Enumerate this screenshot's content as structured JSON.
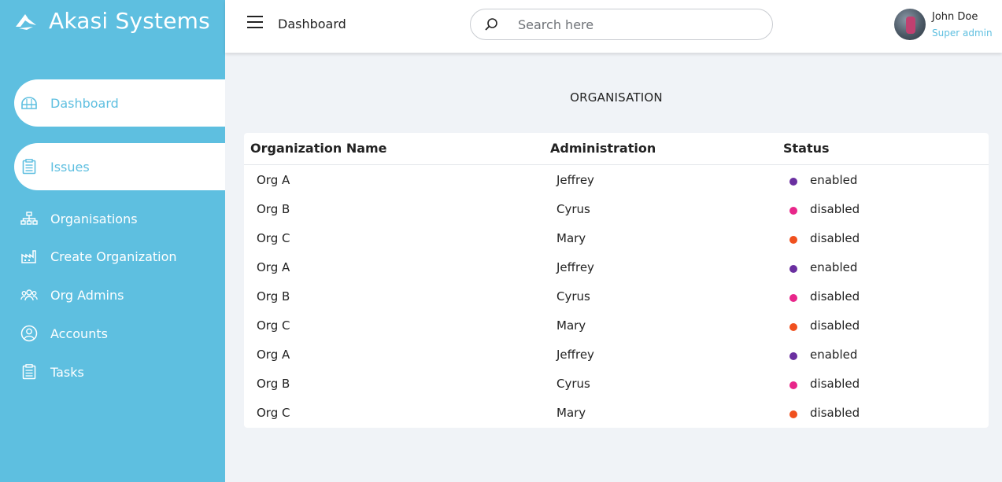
{
  "brand": {
    "name": "Akasi Systems"
  },
  "sidebar": {
    "items": [
      {
        "label": "Dashboard",
        "icon": "dome-icon",
        "active": true
      },
      {
        "label": "Issues",
        "icon": "clipboard-list-icon",
        "active": true
      },
      {
        "label": "Organisations",
        "icon": "org-chart-icon",
        "active": false
      },
      {
        "label": "Create Organization",
        "icon": "factory-icon",
        "active": false
      },
      {
        "label": "Org Admins",
        "icon": "group-icon",
        "active": false
      },
      {
        "label": "Accounts",
        "icon": "user-circle-icon",
        "active": false
      },
      {
        "label": "Tasks",
        "icon": "clipboard-icon",
        "active": false
      }
    ]
  },
  "header": {
    "title": "Dashboard",
    "search": {
      "placeholder": "Search here",
      "value": ""
    },
    "user": {
      "name": "John Doe",
      "role": "Super admin"
    }
  },
  "main": {
    "section_title": "ORGANISATION",
    "table": {
      "columns": [
        "Organization Name",
        "Administration",
        "Status"
      ],
      "rows": [
        {
          "org": "Org A",
          "admin": "Jeffrey",
          "status": "enabled",
          "color": "#6a2fa0"
        },
        {
          "org": "Org B",
          "admin": "Cyrus",
          "status": "disabled",
          "color": "#e8268a"
        },
        {
          "org": "Org C",
          "admin": "Mary",
          "status": "disabled",
          "color": "#f0501e"
        },
        {
          "org": "Org A",
          "admin": "Jeffrey",
          "status": "enabled",
          "color": "#6a2fa0"
        },
        {
          "org": "Org B",
          "admin": "Cyrus",
          "status": "disabled",
          "color": "#e8268a"
        },
        {
          "org": "Org C",
          "admin": "Mary",
          "status": "disabled",
          "color": "#f0501e"
        },
        {
          "org": "Org A",
          "admin": "Jeffrey",
          "status": "enabled",
          "color": "#6a2fa0"
        },
        {
          "org": "Org B",
          "admin": "Cyrus",
          "status": "disabled",
          "color": "#e8268a"
        },
        {
          "org": "Org C",
          "admin": "Mary",
          "status": "disabled",
          "color": "#f0501e"
        }
      ]
    }
  },
  "colors": {
    "accent": "#5ebfe0",
    "background": "#f0f3f7"
  }
}
